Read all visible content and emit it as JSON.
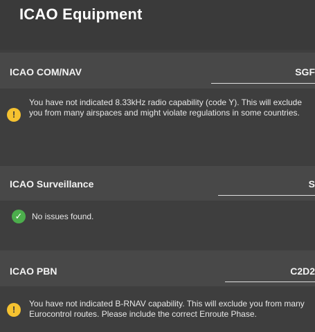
{
  "header": {
    "title": "ICAO Equipment",
    "subtitle": ""
  },
  "fields": {
    "comnav": {
      "label": "ICAO COM/NAV",
      "value": "SGF",
      "message": "You have not indicated 8.33kHz radio capability (code Y). This will exclude you from many airspaces and might violate regulations in some countries.",
      "status": "warning"
    },
    "surveillance": {
      "label": "ICAO Surveillance",
      "value": "S",
      "message": "No issues found.",
      "status": "ok"
    },
    "pbn": {
      "label": "ICAO PBN",
      "value": "C2D2",
      "message": "You have not indicated B-RNAV capability. This will exclude you from many Eurocontrol routes. Please include the correct Enroute Phase.",
      "status": "warning"
    }
  },
  "icons": {
    "warning": "!",
    "ok": "✓"
  },
  "colors": {
    "background": "#3e3e3e",
    "row_background": "#484848",
    "warning": "#f5c230",
    "ok": "#4cae4c"
  }
}
